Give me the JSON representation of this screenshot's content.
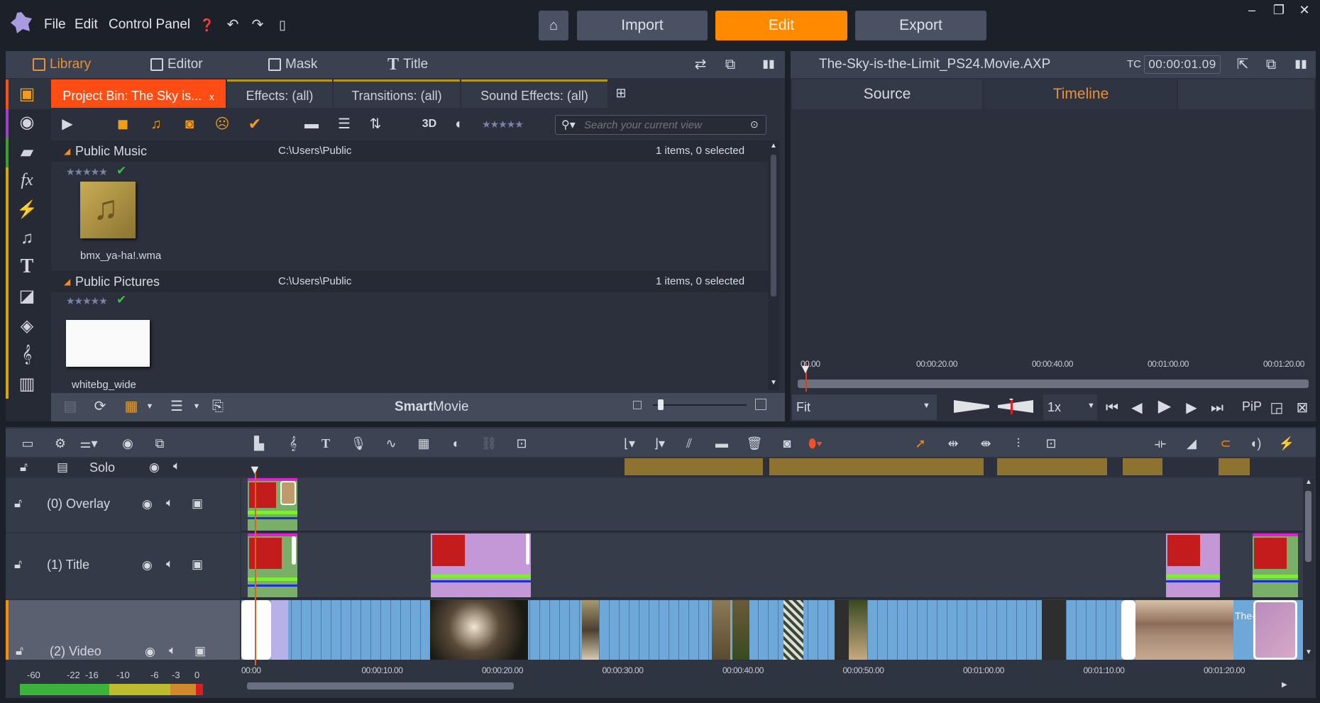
{
  "app": {
    "menu": [
      "File",
      "Edit",
      "Control Panel"
    ],
    "icons": [
      "help-icon",
      "undo-icon",
      "redo-icon",
      "document-icon"
    ],
    "nav": {
      "home_icon": "home-icon",
      "import": "Import",
      "edit": "Edit",
      "export": "Export",
      "active": "Edit"
    },
    "window_controls": [
      "minimize-icon",
      "restore-icon",
      "close-icon"
    ],
    "accent": "#ff8a00"
  },
  "library": {
    "mode_tabs": [
      {
        "label": "Library",
        "icon": "library-icon",
        "active": true
      },
      {
        "label": "Editor",
        "icon": "editor-icon",
        "active": false
      },
      {
        "label": "Mask",
        "icon": "mask-icon",
        "active": false
      },
      {
        "label": "Title",
        "icon": "title-icon",
        "active": false
      }
    ],
    "bin_tabs": [
      {
        "label": "Project Bin: The Sky is...",
        "active": true,
        "closable": "x"
      },
      {
        "label": "Effects: (all)"
      },
      {
        "label": "Transitions: (all)"
      },
      {
        "label": "Sound Effects: (all)"
      }
    ],
    "toolbar": {
      "three_d": "3D",
      "rating": "★★★★★",
      "search_placeholder": "Search your current view"
    },
    "groups": [
      {
        "name": "Public Music",
        "path": "C:\\Users\\Public",
        "count": "1 items, 0 selected",
        "rating": "★★★★★",
        "item": "bmx_ya-ha!.wma"
      },
      {
        "name": "Public Pictures",
        "path": "C:\\Users\\Public",
        "count": "1 items, 0 selected",
        "rating": "★★★★★",
        "item": "whitebg_wide"
      }
    ],
    "footer": {
      "smartmovie_bold": "Smart",
      "smartmovie_rest": "Movie",
      "zoom_slider_fraction": 0.05
    }
  },
  "preview": {
    "title": "The-Sky-is-the-Limit_PS24.Movie.AXP",
    "tc_label": "TC",
    "timecode": "00:00:01.09",
    "tabs": [
      {
        "label": "Source",
        "active": false
      },
      {
        "label": "Timeline",
        "active": true
      }
    ],
    "ruler": [
      "00.00",
      "00:00:20.00",
      "00:00:40.00",
      "00:01:00.00",
      "00:01:20.00"
    ],
    "fit": "Fit",
    "speed": "1x",
    "pip": "PiP"
  },
  "timeline": {
    "solo": "Solo",
    "tracks": [
      {
        "name": "(0) Overlay"
      },
      {
        "name": "(1) Title"
      },
      {
        "name": "(2) Video"
      }
    ],
    "ruler": [
      "00:00",
      "00:00:10.00",
      "00:00:20.00",
      "00:00:30.00",
      "00:00:40.00",
      "00:00:50.00",
      "00:01:00.00",
      "00:01:10.00",
      "00:01:20.00"
    ],
    "meter_labels": [
      "-60",
      "-22",
      "-16",
      "-10",
      "-6",
      "-3",
      "0"
    ],
    "video_title_clip": "The-Sky-is-t..."
  }
}
